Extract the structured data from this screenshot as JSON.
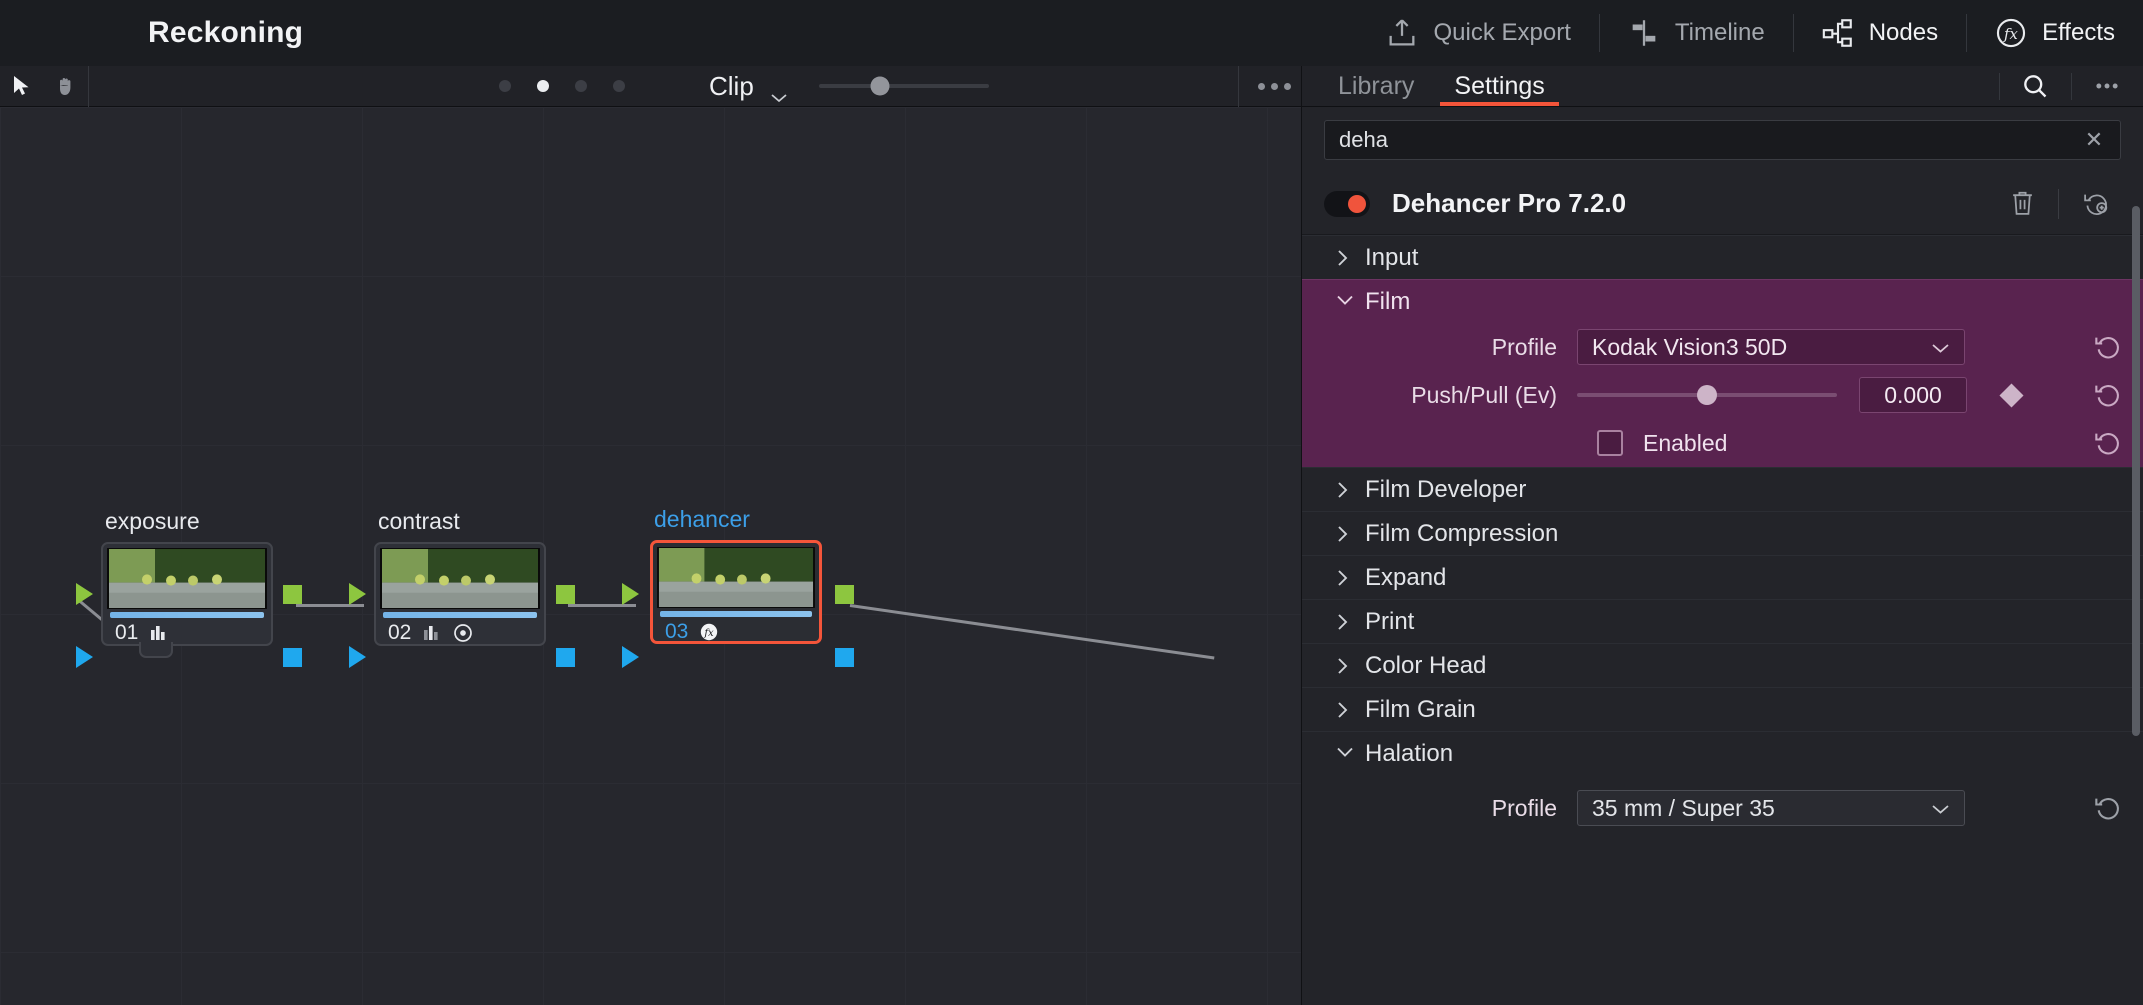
{
  "topbar": {
    "project_title": "Reckoning",
    "items": [
      {
        "label": "Quick Export",
        "icon": "export-icon",
        "active": false
      },
      {
        "label": "Timeline",
        "icon": "timeline-icon",
        "active": false
      },
      {
        "label": "Nodes",
        "icon": "nodes-icon",
        "active": true
      },
      {
        "label": "Effects",
        "icon": "effects-fx-icon",
        "active": true
      }
    ]
  },
  "node_toolbar": {
    "cursor_tool": "cursor-arrow-icon",
    "hand_tool": "hand-pan-icon",
    "page_dots": [
      false,
      true,
      false,
      false
    ],
    "scope_label": "Clip",
    "zoom_value": 36,
    "more_label": "..."
  },
  "node_graph": {
    "nodes": [
      {
        "label": "exposure",
        "number": "01",
        "icons": [
          "histogram-icon"
        ],
        "selected": false
      },
      {
        "label": "contrast",
        "number": "02",
        "icons": [
          "histogram-icon",
          "circle-dot-icon"
        ],
        "selected": false
      },
      {
        "label": "dehancer",
        "number": "03",
        "icons": [
          "fx-icon"
        ],
        "selected": true
      }
    ]
  },
  "inspector": {
    "tabs": [
      {
        "label": "Library",
        "active": false
      },
      {
        "label": "Settings",
        "active": true
      }
    ],
    "search_icon": "search-icon",
    "more_icon": "more-options-icon",
    "search": {
      "value": "deha",
      "placeholder": "Search",
      "clear_label": "✕"
    },
    "plugin": {
      "name": "Dehancer Pro 7.2.0",
      "enabled": true,
      "delete_icon": "trash-icon",
      "reset_icon": "reset-all-icon"
    },
    "sections": [
      {
        "label": "Input",
        "expanded": false
      },
      {
        "label": "Film Developer",
        "expanded": false
      },
      {
        "label": "Film Compression",
        "expanded": false
      },
      {
        "label": "Expand",
        "expanded": false
      },
      {
        "label": "Print",
        "expanded": false
      },
      {
        "label": "Color Head",
        "expanded": false
      },
      {
        "label": "Film Grain",
        "expanded": false
      },
      {
        "label": "Halation",
        "expanded": true
      }
    ],
    "film_section": {
      "label": "Film",
      "expanded": true,
      "profile": {
        "label": "Profile",
        "value": "Kodak Vision3 50D"
      },
      "push_pull": {
        "label": "Push/Pull (Ev)",
        "value": "0.000",
        "slider_pct": 50
      },
      "enabled": {
        "label": "Enabled",
        "checked": false
      }
    },
    "halation_section": {
      "profile": {
        "label": "Profile",
        "value": "35 mm / Super 35"
      }
    }
  },
  "colors": {
    "accent_orange": "#f4553a",
    "film_highlight": "#59234f",
    "port_green": "#8dc63f",
    "port_blue": "#1fa8ee",
    "toggle_on": "#f0543c",
    "node_selected_border": "#f4553a",
    "node_selected_text": "#3c9fe8"
  }
}
